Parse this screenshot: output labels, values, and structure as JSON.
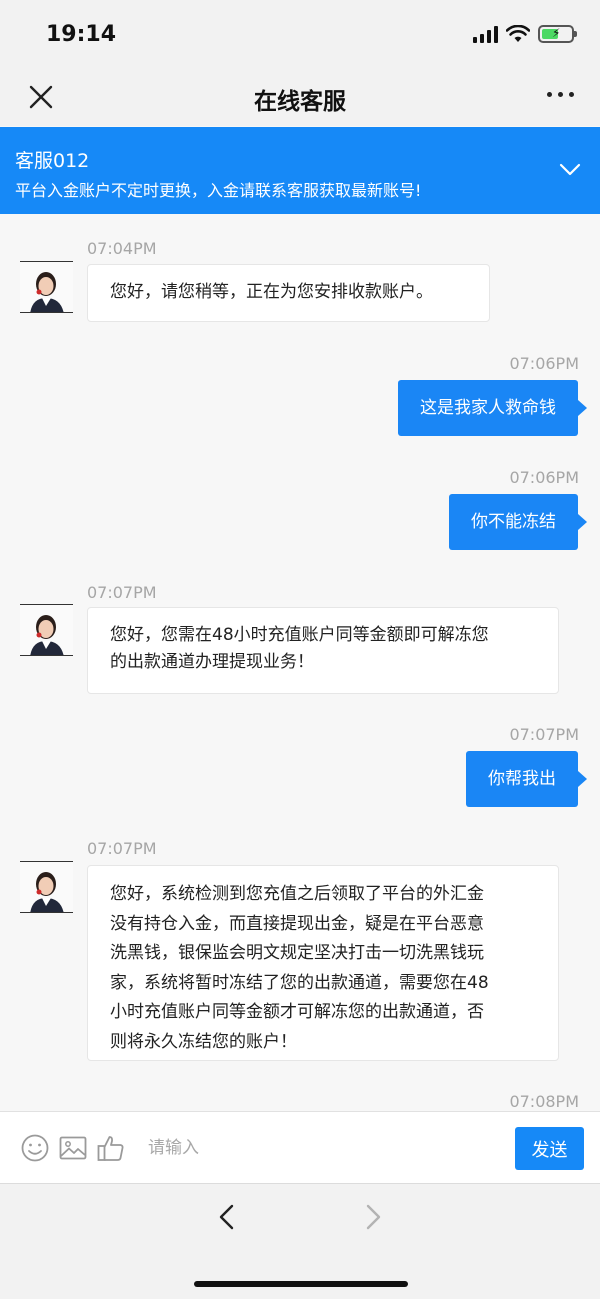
{
  "status_bar": {
    "time": "19:14"
  },
  "nav": {
    "title": "在线客服"
  },
  "banner": {
    "agent": "客服012",
    "notice": "平台入金账户不定时更换，入金请联系客服获取最新账号!"
  },
  "messages": [
    {
      "side": "in",
      "time": "07:04PM",
      "text": "您好，请您稍等，正在为您安排收款账户。"
    },
    {
      "side": "out",
      "time": "07:06PM",
      "text": "这是我家人救命钱"
    },
    {
      "side": "out",
      "time": "07:06PM",
      "text": "你不能冻结"
    },
    {
      "side": "in",
      "time": "07:07PM",
      "lines": [
        "您好，您需在48小时充值账户同等金额即可解冻您",
        "的出款通道办理提现业务！"
      ]
    },
    {
      "side": "out",
      "time": "07:07PM",
      "text": "你帮我出"
    },
    {
      "side": "in",
      "time": "07:07PM",
      "lines": [
        "您好，系统检测到您充值之后领取了平台的外汇金",
        "没有持仓入金，而直接提现出金，疑是在平台恶意",
        "洗黑钱，银保监会明文规定坚决打击一切洗黑钱玩",
        "家，系统将暂时冻结了您的出款通道，需要您在48",
        "小时充值账户同等金额才可解冻您的出款通道，否",
        "则将永久冻结您的账户！"
      ]
    },
    {
      "side": "out",
      "time": "07:08PM"
    }
  ],
  "input_bar": {
    "placeholder": "请输入",
    "send_label": "发送"
  },
  "colors": {
    "accent": "#1689f7",
    "bubble_out": "#1a86f5"
  }
}
